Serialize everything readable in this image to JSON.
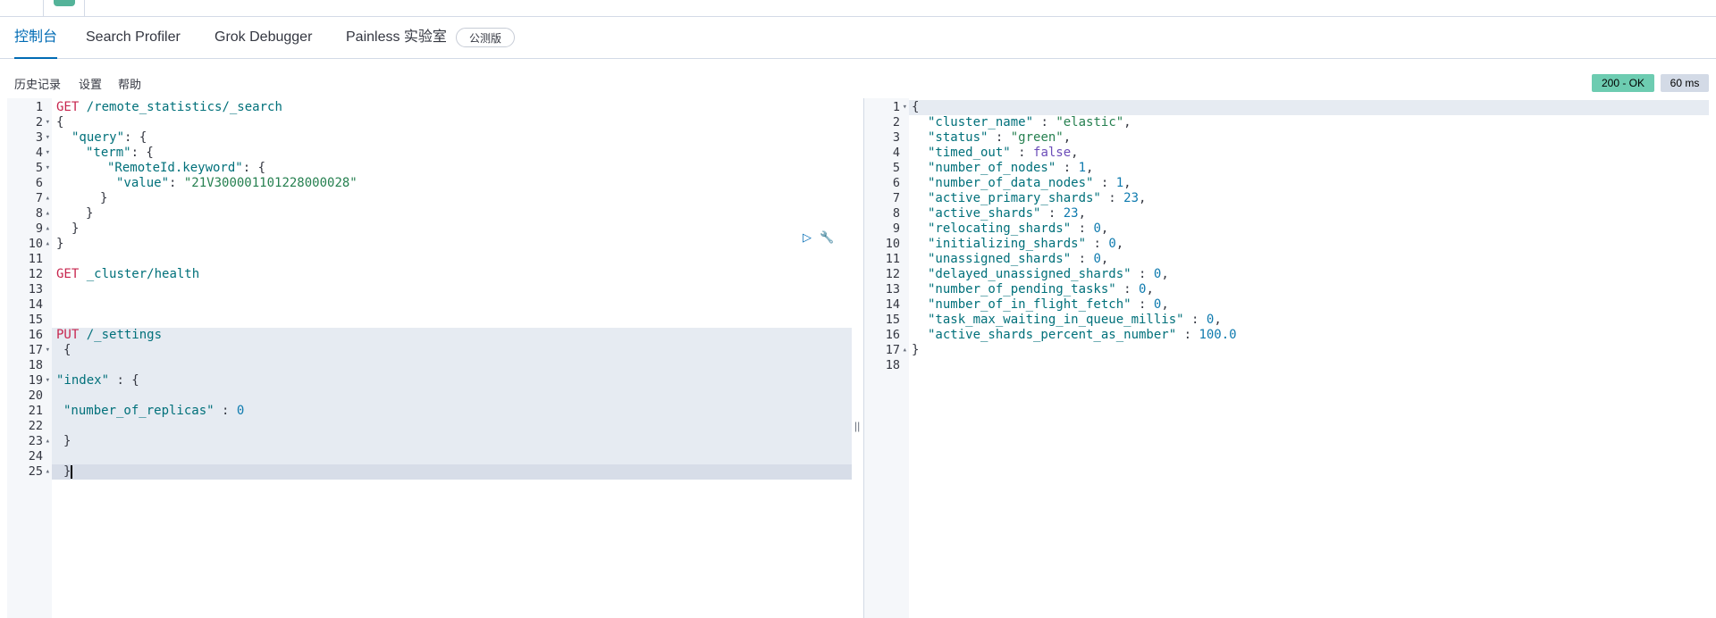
{
  "tabs": {
    "console": "控制台",
    "search_profiler": "Search Profiler",
    "grok_debugger": "Grok Debugger",
    "painless": "Painless 实验室",
    "beta": "公测版"
  },
  "toolbar": {
    "history": "历史记录",
    "settings": "设置",
    "help": "帮助",
    "status": "200 - OK",
    "time": "60 ms"
  },
  "request": {
    "line_numbers": [
      "1",
      "2",
      "3",
      "4",
      "5",
      "6",
      "7",
      "8",
      "9",
      "10",
      "11",
      "12",
      "13",
      "14",
      "15",
      "16",
      "17",
      "18",
      "19",
      "20",
      "21",
      "22",
      "23",
      "24",
      "25"
    ],
    "l1_method": "GET",
    "l1_url": "/remote_statistics/_search",
    "l2": "{",
    "l3_key": "\"query\"",
    "l3_rest": ": {",
    "l4_key": "\"term\"",
    "l4_rest": ": {",
    "l5_key": "\"RemoteId.keyword\"",
    "l5_rest": ": {",
    "l6_key": "\"value\"",
    "l6_colon": ": ",
    "l6_val": "\"21V300001101228000028\"",
    "l7": "}",
    "l8": "}",
    "l9": "}",
    "l10": "}",
    "l12_method": "GET",
    "l12_url": "_cluster/health",
    "l16_method": "PUT",
    "l16_url": "/_settings",
    "l17": "{",
    "l19_key": "\"index\"",
    "l19_rest": " : {",
    "l21_key": "\"number_of_replicas\"",
    "l21_colon": " : ",
    "l21_val": "0",
    "l23": "}",
    "l25": "}"
  },
  "response": {
    "line_numbers": [
      "1",
      "2",
      "3",
      "4",
      "5",
      "6",
      "7",
      "8",
      "9",
      "10",
      "11",
      "12",
      "13",
      "14",
      "15",
      "16",
      "17",
      "18"
    ],
    "open": "{",
    "close": "}",
    "fields": [
      {
        "key": "\"cluster_name\"",
        "value": "\"elastic\"",
        "type": "str"
      },
      {
        "key": "\"status\"",
        "value": "\"green\"",
        "type": "str"
      },
      {
        "key": "\"timed_out\"",
        "value": "false",
        "type": "bool"
      },
      {
        "key": "\"number_of_nodes\"",
        "value": "1",
        "type": "num"
      },
      {
        "key": "\"number_of_data_nodes\"",
        "value": "1",
        "type": "num"
      },
      {
        "key": "\"active_primary_shards\"",
        "value": "23",
        "type": "num"
      },
      {
        "key": "\"active_shards\"",
        "value": "23",
        "type": "num"
      },
      {
        "key": "\"relocating_shards\"",
        "value": "0",
        "type": "num"
      },
      {
        "key": "\"initializing_shards\"",
        "value": "0",
        "type": "num"
      },
      {
        "key": "\"unassigned_shards\"",
        "value": "0",
        "type": "num"
      },
      {
        "key": "\"delayed_unassigned_shards\"",
        "value": "0",
        "type": "num"
      },
      {
        "key": "\"number_of_pending_tasks\"",
        "value": "0",
        "type": "num"
      },
      {
        "key": "\"number_of_in_flight_fetch\"",
        "value": "0",
        "type": "num"
      },
      {
        "key": "\"task_max_waiting_in_queue_millis\"",
        "value": "0",
        "type": "num"
      },
      {
        "key": "\"active_shards_percent_as_number\"",
        "value": "100.0",
        "type": "num"
      }
    ]
  },
  "icons": {
    "run": "▷",
    "wrench": "🔧",
    "resize": "||"
  },
  "colors": {
    "accent": "#006bb4",
    "status_ok": "#6dccb1",
    "status_time": "#d3dae6"
  }
}
